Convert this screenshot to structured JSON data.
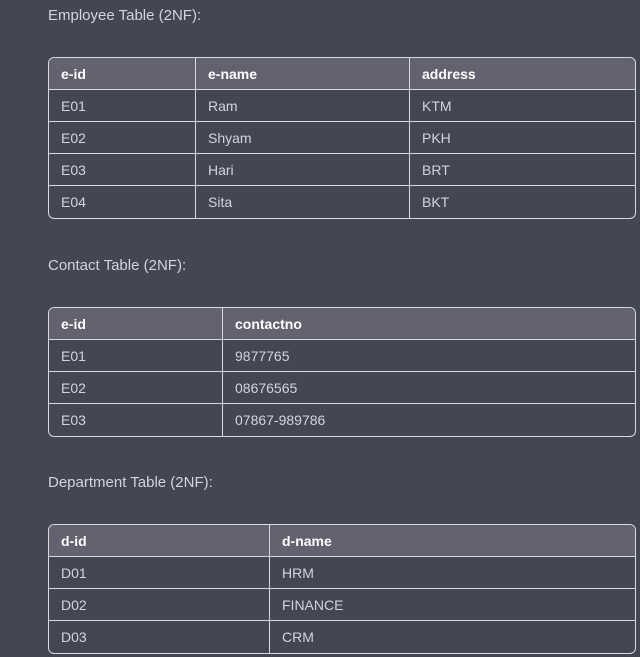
{
  "employee": {
    "title": "Employee Table (2NF):",
    "headers": [
      "e-id",
      "e-name",
      "address"
    ],
    "rows": [
      [
        "E01",
        "Ram",
        "KTM"
      ],
      [
        "E02",
        "Shyam",
        "PKH"
      ],
      [
        "E03",
        "Hari",
        "BRT"
      ],
      [
        "E04",
        "Sita",
        "BKT"
      ]
    ]
  },
  "contact": {
    "title": "Contact Table (2NF):",
    "headers": [
      "e-id",
      "contactno"
    ],
    "rows": [
      [
        "E01",
        "9877765"
      ],
      [
        "E02",
        "08676565"
      ],
      [
        "E03",
        "07867-989786"
      ]
    ]
  },
  "department": {
    "title": "Department Table (2NF):",
    "headers": [
      "d-id",
      "d-name"
    ],
    "rows": [
      [
        "D01",
        "HRM"
      ],
      [
        "D02",
        "FINANCE"
      ],
      [
        "D03",
        "CRM"
      ]
    ]
  }
}
